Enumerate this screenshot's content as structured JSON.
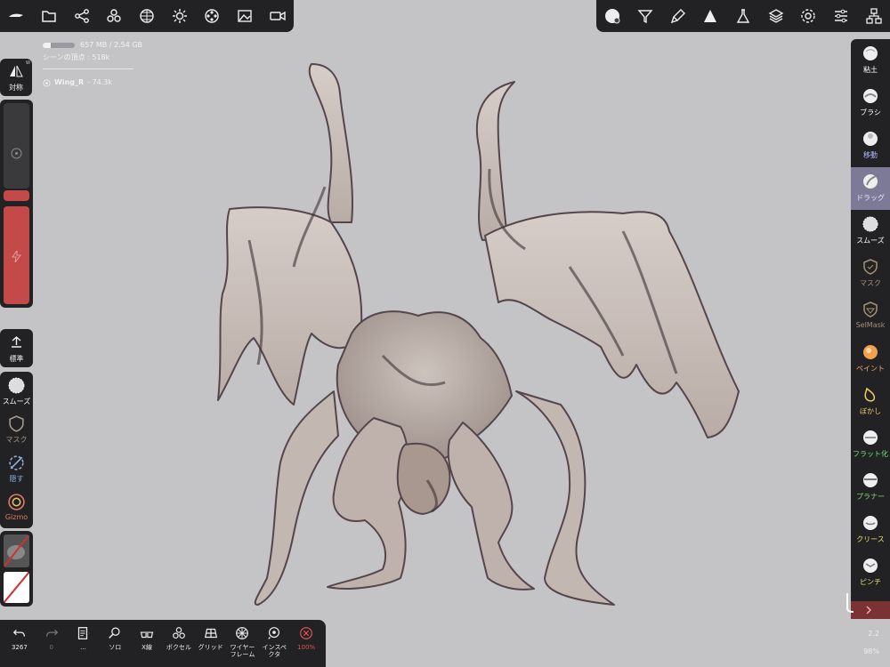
{
  "colors": {
    "background": "#c4c4c6",
    "panel": "#222224",
    "accent_active": "#7d7a97",
    "slider_red": "#c44a4a",
    "sculpt_light": "#cfc5c0",
    "sculpt_dark": "#3e3336"
  },
  "top_left_toolbar": {
    "icons": [
      "scene-icon",
      "folder-icon",
      "share-nodes-icon",
      "scene-group-icon",
      "wireframe-sphere-icon",
      "light-sun-icon",
      "film-reel-icon",
      "image-icon",
      "video-camera-icon"
    ]
  },
  "top_right_toolbar": {
    "icons": [
      "material-sphere-icon",
      "filter-icon",
      "paint-brush-icon",
      "triangle-icon",
      "flask-icon",
      "layers-icon",
      "settings-gear-icon",
      "sliders-icon",
      "tree-icon"
    ]
  },
  "info": {
    "memory_text": "657 MB / 2.54 GB",
    "memory_fraction": 0.25,
    "vertices_text": "シーンの頂点 : 518k",
    "object_name": "Wing_R",
    "object_count": "- 74.3k"
  },
  "left_panel": {
    "symmetry": {
      "label": "対称",
      "badge": "W"
    },
    "standard": {
      "label": "標準"
    },
    "tools": [
      {
        "label": "スムーズ",
        "color": "#ffffff"
      },
      {
        "label": "マスク",
        "color": "#a89a8a"
      },
      {
        "label": "隠す",
        "color": "#8fb0e0"
      },
      {
        "label": "Gizmo",
        "color": "#e07a6a"
      }
    ]
  },
  "right_tools": [
    {
      "label": "粘土",
      "color": "#ffffff"
    },
    {
      "label": "ブラシ",
      "color": "#ffffff"
    },
    {
      "label": "移動",
      "color": "#b0b8ff"
    },
    {
      "label": "ドラッグ",
      "color": "#e8e4ff"
    },
    {
      "label": "スムーズ",
      "color": "#ffffff"
    },
    {
      "label": "マスク",
      "color": "#a48f78"
    },
    {
      "label": "SelMask",
      "color": "#a48f78"
    },
    {
      "label": "ペイント",
      "color": "#f0b070"
    },
    {
      "label": "ぼかし",
      "color": "#f0d060"
    },
    {
      "label": "フラット化",
      "color": "#70e070"
    },
    {
      "label": "プラナー",
      "color": "#70e070"
    },
    {
      "label": "クリース",
      "color": "#e0e070"
    },
    {
      "label": "ピンチ",
      "color": "#e0e070"
    }
  ],
  "bottom_toolbar": {
    "items": [
      {
        "label": "3267",
        "icon": "undo-icon"
      },
      {
        "label": "0",
        "icon": "redo-icon"
      },
      {
        "label": "...",
        "icon": "document-icon"
      },
      {
        "label": "ソロ",
        "icon": "search-icon"
      },
      {
        "label": "X線",
        "icon": "xray-glasses-icon"
      },
      {
        "label": "ボクセル",
        "icon": "voxel-icon"
      },
      {
        "label": "グリッド",
        "icon": "grid-icon"
      },
      {
        "label": "ワイヤーフレーム",
        "icon": "wireframe-icon"
      },
      {
        "label": "インスペクタ",
        "icon": "inspector-icon"
      },
      {
        "label": "100%",
        "icon": "close-circle-icon"
      }
    ]
  },
  "bottom_right": {
    "value_top": "2.2",
    "value_bottom": "98%"
  }
}
